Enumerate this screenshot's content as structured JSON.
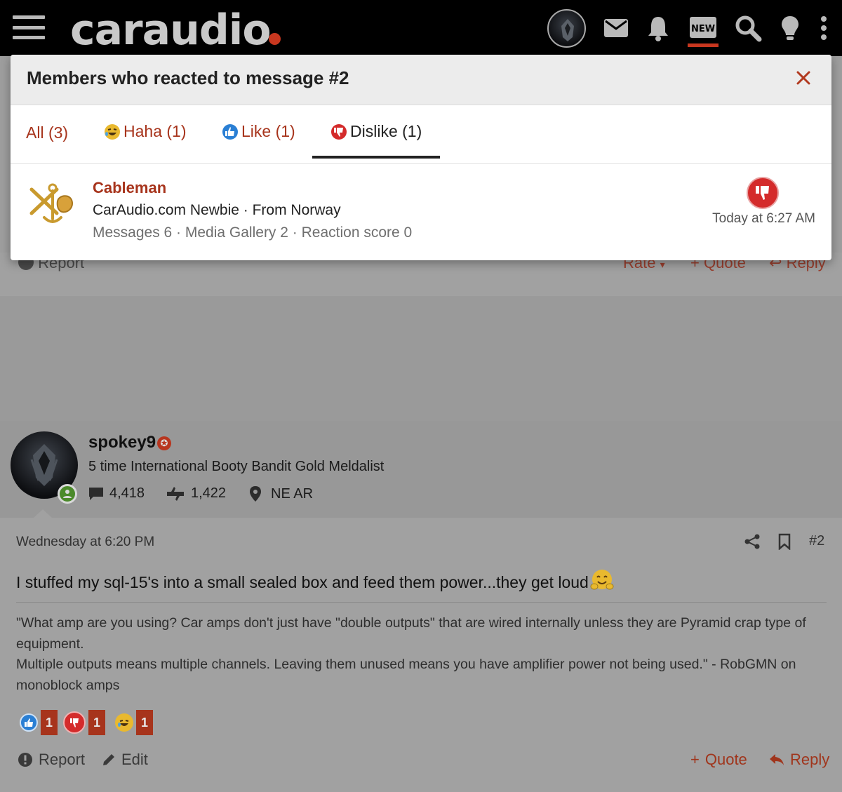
{
  "header": {
    "logo": "caraudio",
    "icons": [
      "menu-icon",
      "avatar",
      "mail-icon",
      "bell-icon",
      "new-posts-icon",
      "search-icon",
      "lightbulb-icon",
      "more-vertical-icon"
    ],
    "new_label": "NEW"
  },
  "modal": {
    "title": "Members who reacted to message #2",
    "tabs": [
      {
        "label": "All (3)",
        "icon": ""
      },
      {
        "label": "Haha (1)",
        "icon": "haha-icon"
      },
      {
        "label": "Like (1)",
        "icon": "like-icon"
      },
      {
        "label": "Dislike (1)",
        "icon": "dislike-icon"
      }
    ],
    "active_tab": "Dislike (1)",
    "member": {
      "name": "Cableman",
      "title_line": "CarAudio.com Newbie · From Norway",
      "stats_line": "Messages  6 · Media Gallery  2 · Reaction score  0",
      "reaction": "dislike",
      "time": "Today at 6:27 AM"
    }
  },
  "previous_post_actions": {
    "report": "Report",
    "rate": "Rate",
    "quote": "Quote",
    "reply": "Reply"
  },
  "post": {
    "author": {
      "name": "spokey9",
      "title": "5 time International Booty Bandit Gold Meldalist",
      "messages": "4,418",
      "reactions": "1,422",
      "location": "NE AR"
    },
    "date": "Wednesday at 6:20 PM",
    "number": "#2",
    "text": "I stuffed my sql-15's into a small sealed box and feed them power...they get loud",
    "signature": "\"What amp are you using? Car amps don't just have \"double outputs\" that are wired internally unless they are Pyramid crap type of equipment.\nMultiple outputs means multiple channels. Leaving them unused means you have amplifier power not being used.\" - RobGMN on monoblock amps",
    "reactions": [
      {
        "type": "like",
        "count": "1"
      },
      {
        "type": "dislike",
        "count": "1"
      },
      {
        "type": "haha",
        "count": "1"
      }
    ],
    "actions": {
      "report": "Report",
      "edit": "Edit",
      "quote": "Quote",
      "reply": "Reply"
    }
  },
  "colors": {
    "accent": "#a7341c",
    "topbar": "#000000",
    "dislike": "#d42b2b",
    "like": "#2a7fd4"
  }
}
